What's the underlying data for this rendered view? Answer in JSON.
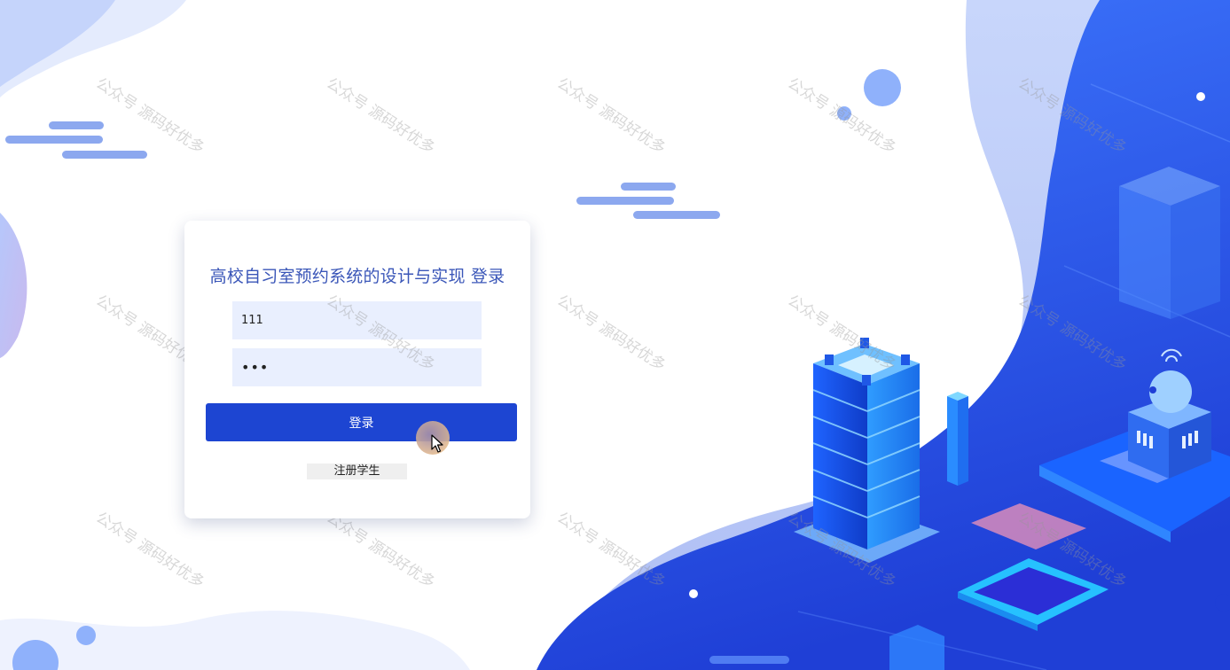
{
  "login": {
    "title": "高校自习室预约系统的设计与实现 登录",
    "username_value": "111",
    "password_value": "•••",
    "login_button": "登录",
    "register_link": "注册学生"
  },
  "watermark": "公众号 源码好优多",
  "colors": {
    "primary": "#1d45d2",
    "title": "#3a56b8",
    "input_bg": "#e9effe",
    "background_blue": "#2a5ae8"
  }
}
